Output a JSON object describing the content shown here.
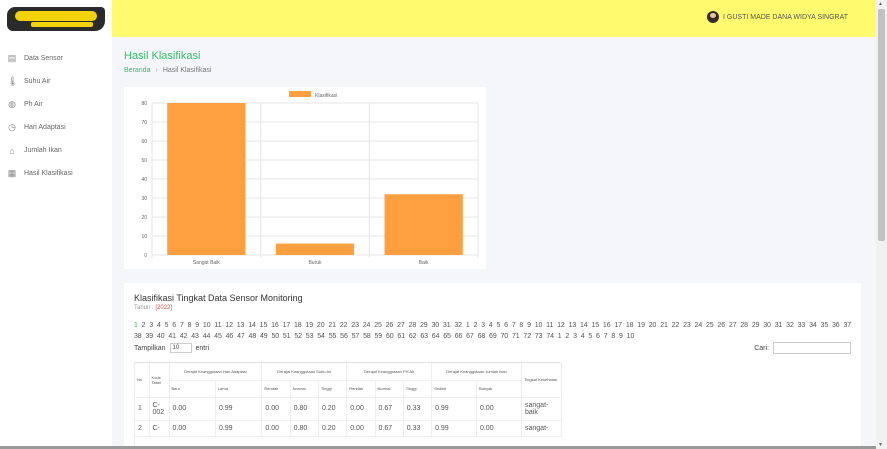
{
  "header": {
    "user_name": "I GUSTI MADE DANA WIDYA SINGRAT"
  },
  "sidebar": {
    "items": [
      {
        "label": "Data Sensor",
        "icon": "document-icon"
      },
      {
        "label": "Suhu Air",
        "icon": "thermometer-icon"
      },
      {
        "label": "Ph Air",
        "icon": "globe-icon"
      },
      {
        "label": "Hari Adaptasi",
        "icon": "clock-icon"
      },
      {
        "label": "Jumlah Ikan",
        "icon": "basket-icon"
      },
      {
        "label": "Hasil Klasifikasi",
        "icon": "table-icon"
      }
    ]
  },
  "page": {
    "title": "Hasil Klasifikasi",
    "breadcrumb": [
      "Beranda",
      "Hasil Klasifikasi"
    ]
  },
  "chart_data": {
    "type": "bar",
    "categories": [
      "Sangat Baik",
      "Buruk",
      "Baik"
    ],
    "series": [
      {
        "name": "Klasifikasi",
        "values": [
          80,
          6,
          32
        ],
        "color": "#ff9f40"
      }
    ],
    "ylim": [
      0,
      80
    ],
    "yticks": [
      0,
      10,
      20,
      30,
      40,
      50,
      60,
      70,
      80
    ],
    "grid": true,
    "legend_position": "top-center"
  },
  "table_section": {
    "title": "Klasifikasi Tingkat Data Sensor Monitoring",
    "year_label": "Tahun :",
    "year": "[2022]",
    "pages_first": [
      "1",
      "2"
    ],
    "pages_second": [
      "3",
      "4",
      "5",
      "6",
      "7",
      "8",
      "9",
      "10",
      "11",
      "12",
      "13",
      "14",
      "15",
      "16",
      "17",
      "18",
      "19",
      "20",
      "21",
      "22",
      "23",
      "24",
      "25",
      "26",
      "27",
      "28",
      "29",
      "30",
      "31",
      "32"
    ],
    "pages_third": [
      "1",
      "2",
      "3",
      "4",
      "5",
      "6",
      "7",
      "8",
      "9",
      "10",
      "11",
      "12",
      "13",
      "14",
      "15",
      "16",
      "17",
      "18",
      "19",
      "20",
      "21",
      "22",
      "23",
      "24",
      "25",
      "26",
      "27",
      "28",
      "29",
      "30",
      "31",
      "32",
      "33",
      "34",
      "35",
      "36",
      "37",
      "38",
      "39",
      "40",
      "41",
      "42",
      "43",
      "44",
      "45",
      "46",
      "47",
      "48",
      "49",
      "50",
      "51",
      "52",
      "53",
      "54",
      "55",
      "56",
      "57",
      "58",
      "59",
      "60",
      "61",
      "62",
      "63",
      "64",
      "65",
      "66",
      "67",
      "68",
      "69",
      "70",
      "71",
      "72",
      "73",
      "74"
    ],
    "pages_fourth": [
      "1",
      "2",
      "3",
      "4",
      "5",
      "6",
      "7",
      "8",
      "9",
      "10"
    ],
    "length_label": "Tampilkan",
    "length_value": "10",
    "length_suffix": "entri",
    "search_label": "Cari:",
    "groups": [
      "Derajat Keanggotaan Hari Adaptasi",
      "Derajat Keanggotaan Suhu Air",
      "Derajat Keanggotaan PH Air",
      "Derajat Keanggotaan Jumlah Ikan"
    ],
    "columns": {
      "no": "No",
      "kode": "Kode Tabel",
      "baru": "Baru",
      "lama": "Lama",
      "rendah": "Rendah",
      "normal": "Normal",
      "tinggi": "Tinggi",
      "sedikit": "Sedikit",
      "banyak": "Banyak",
      "tingkat": "Tingkat Kesehatan"
    },
    "rows": [
      {
        "no": "1",
        "kode": "C-002",
        "hari_baru": "0.00",
        "hari_lama": "0.99",
        "suhu_rendah": "0.00",
        "suhu_normal": "0.80",
        "suhu_tinggi": "0.20",
        "ph_rendah": "0.00",
        "ph_normal": "0.67",
        "ph_tinggi": "0.33",
        "ikan_sedikit": "0.99",
        "ikan_banyak": "0.00",
        "tingkat": "sangat-baik"
      },
      {
        "no": "2",
        "kode": "C-",
        "hari_baru": "0.00",
        "hari_lama": "0.99",
        "suhu_rendah": "0.00",
        "suhu_normal": "0.80",
        "suhu_tinggi": "0.20",
        "ph_rendah": "0.00",
        "ph_normal": "0.67",
        "ph_tinggi": "0.33",
        "ikan_sedikit": "0.99",
        "ikan_banyak": "0.00",
        "tingkat": "sangat-"
      }
    ]
  }
}
